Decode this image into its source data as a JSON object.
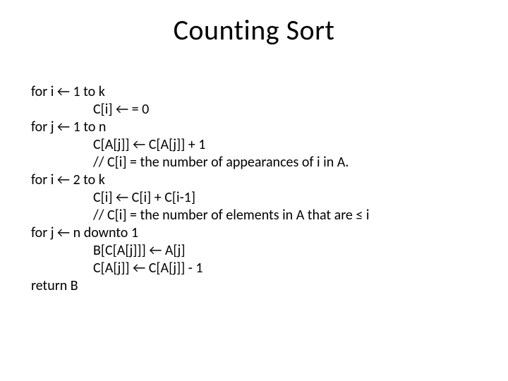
{
  "title": "Counting Sort",
  "lines": [
    {
      "text": "for i ← 1 to k",
      "indent": false
    },
    {
      "text": "C[i] ← = 0",
      "indent": true
    },
    {
      "text": "for j ← 1 to n",
      "indent": false
    },
    {
      "text": "C[A[j]] ← C[A[j]] + 1",
      "indent": true
    },
    {
      "text": "// C[i] = the number of appearances of i in A.",
      "indent": true
    },
    {
      "text": "for i ← 2 to k",
      "indent": false
    },
    {
      "text": "C[i] ← C[i] + C[i-1]",
      "indent": true
    },
    {
      "text": "// C[i] = the number of elements in A that are ≤ i",
      "indent": true
    },
    {
      "text": "for j ← n downto 1",
      "indent": false
    },
    {
      "text": "B[C[A[j]]] ← A[j]",
      "indent": true
    },
    {
      "text": "C[A[j]] ← C[A[j]] - 1",
      "indent": true
    },
    {
      "text": "return B",
      "indent": false
    }
  ]
}
